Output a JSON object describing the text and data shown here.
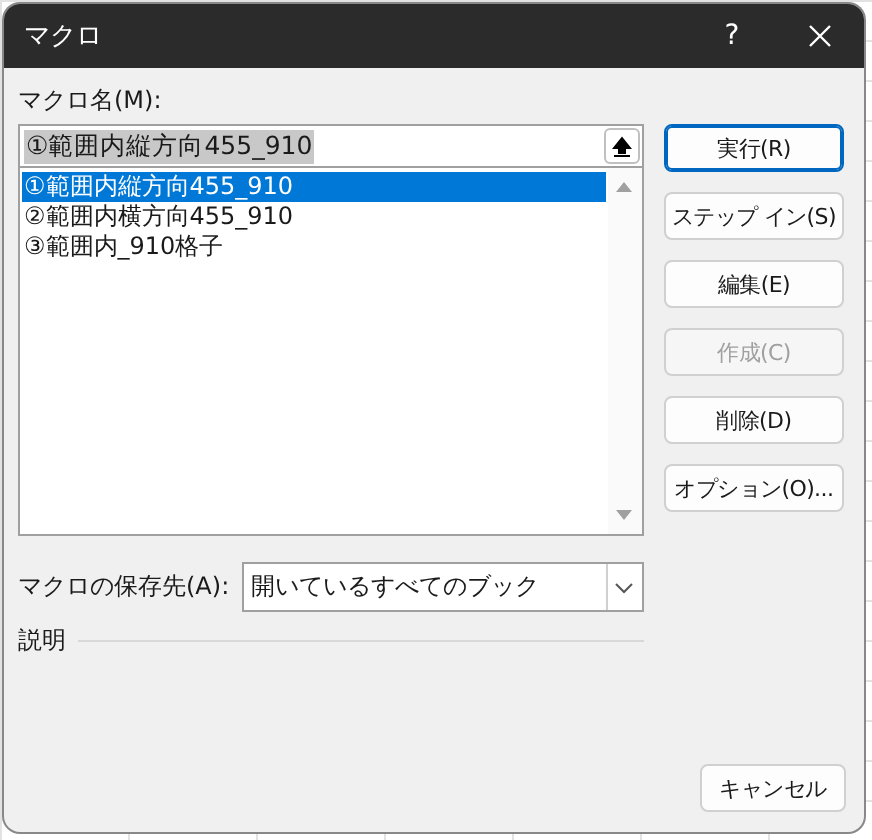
{
  "window": {
    "title": "マクロ",
    "help": "?"
  },
  "macro_name": {
    "label": "マクロ名(M):",
    "value": "①範囲内縦方向455_910"
  },
  "macros": [
    {
      "name": "①範囲内縦方向455_910",
      "selected": true
    },
    {
      "name": "②範囲内横方向455_910",
      "selected": false
    },
    {
      "name": "③範囲内_910格子",
      "selected": false
    }
  ],
  "buttons": [
    {
      "label": "実行(R)",
      "default": true,
      "disabled": false
    },
    {
      "label": "ステップ イン(S)",
      "default": false,
      "disabled": false
    },
    {
      "label": "編集(E)",
      "default": false,
      "disabled": false
    },
    {
      "label": "作成(C)",
      "default": false,
      "disabled": true
    },
    {
      "label": "削除(D)",
      "default": false,
      "disabled": false
    },
    {
      "label": "オプション(O)...",
      "default": false,
      "disabled": false
    }
  ],
  "macros_in": {
    "label": "マクロの保存先(A):",
    "value": "開いているすべてのブック"
  },
  "description": {
    "label": "説明"
  },
  "cancel_button": "キャンセル"
}
